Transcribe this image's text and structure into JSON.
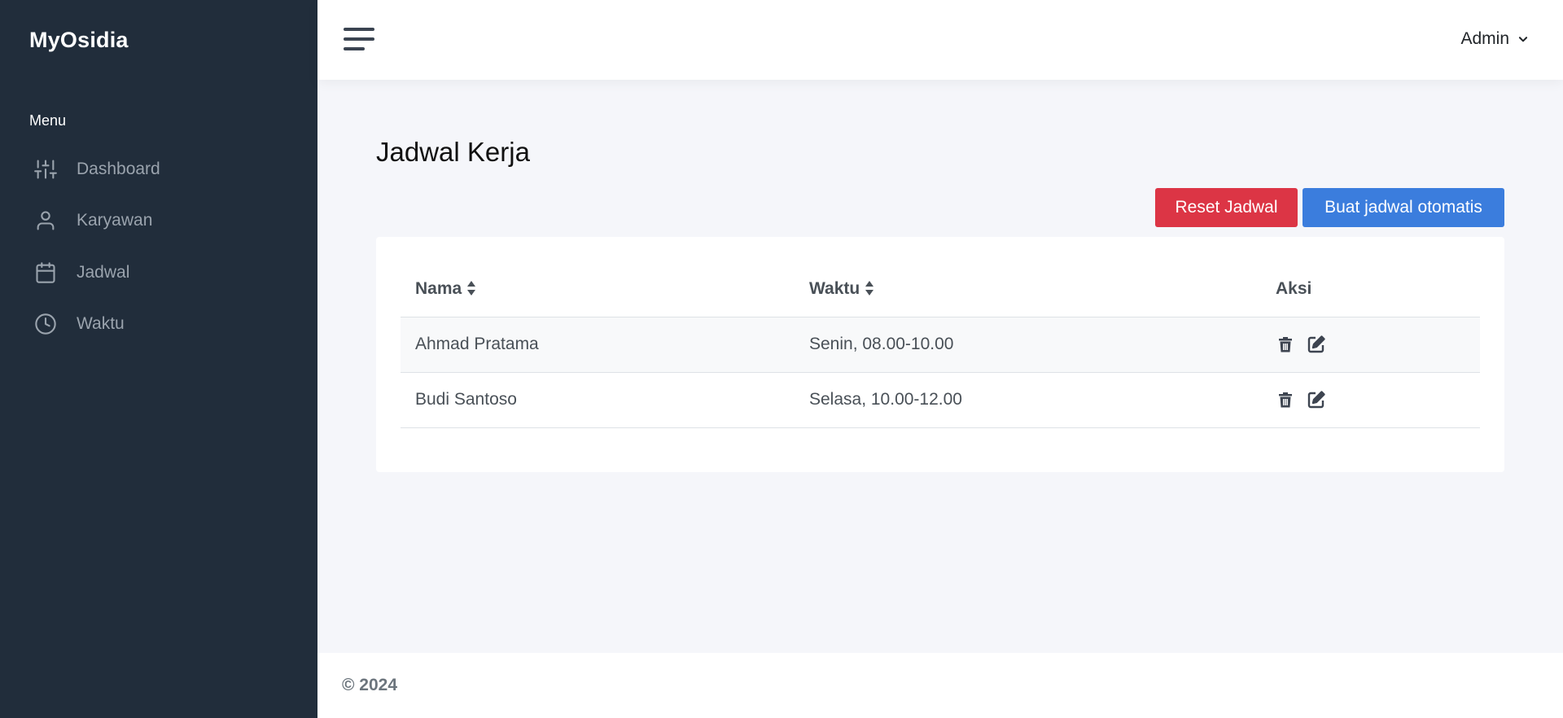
{
  "sidebar": {
    "brand": "MyOsidia",
    "menu_header": "Menu",
    "items": [
      {
        "label": "Dashboard",
        "icon": "sliders-icon"
      },
      {
        "label": "Karyawan",
        "icon": "user-icon"
      },
      {
        "label": "Jadwal",
        "icon": "calendar-icon"
      },
      {
        "label": "Waktu",
        "icon": "clock-icon"
      }
    ]
  },
  "topbar": {
    "user_label": "Admin"
  },
  "main": {
    "title": "Jadwal Kerja",
    "reset_button": "Reset Jadwal",
    "auto_button": "Buat jadwal otomatis"
  },
  "table": {
    "headers": [
      "Nama",
      "Waktu",
      "Aksi"
    ],
    "rows": [
      {
        "nama": "Ahmad Pratama",
        "waktu": "Senin, 08.00-10.00"
      },
      {
        "nama": "Budi Santoso",
        "waktu": "Selasa, 10.00-12.00"
      }
    ]
  },
  "footer": {
    "text": "© 2024"
  },
  "colors": {
    "sidebar_bg": "#212d3b",
    "danger": "#dc3545",
    "primary": "#3b7ddd",
    "page_bg": "#f5f6fa"
  }
}
